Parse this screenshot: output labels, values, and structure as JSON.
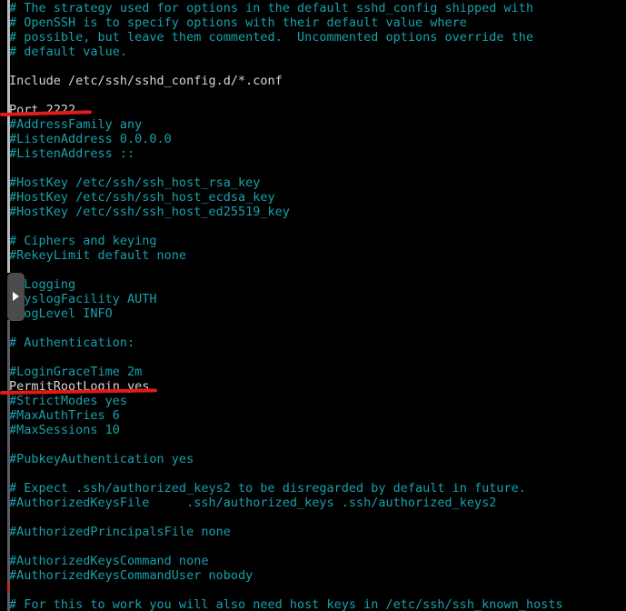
{
  "editor": {
    "colors": {
      "background": "#000000",
      "comment_text": "#17a1ab",
      "active_text": "#d6d6d6",
      "annotation": "#e01b18",
      "scrollbar_thumb": "#4b4b4b",
      "scrollbar_track": "#b9b9b9",
      "scrollbar_marker": "#c0261f"
    },
    "lines": [
      {
        "text": "# The strategy used for options in the default sshd_config shipped with",
        "style": "comment"
      },
      {
        "text": "# OpenSSH is to specify options with their default value where",
        "style": "comment"
      },
      {
        "text": "# possible, but leave them commented.  Uncommented options override the",
        "style": "comment"
      },
      {
        "text": "# default value.",
        "style": "comment"
      },
      {
        "text": "",
        "style": "blank"
      },
      {
        "text": "Include /etc/ssh/sshd_config.d/*.conf",
        "style": "active"
      },
      {
        "text": "",
        "style": "blank"
      },
      {
        "text": "Port 2222",
        "style": "active"
      },
      {
        "text": "#AddressFamily any",
        "style": "comment"
      },
      {
        "text": "#ListenAddress 0.0.0.0",
        "style": "comment"
      },
      {
        "text": "#ListenAddress ::",
        "style": "comment"
      },
      {
        "text": "",
        "style": "blank"
      },
      {
        "text": "#HostKey /etc/ssh/ssh_host_rsa_key",
        "style": "comment"
      },
      {
        "text": "#HostKey /etc/ssh/ssh_host_ecdsa_key",
        "style": "comment"
      },
      {
        "text": "#HostKey /etc/ssh/ssh_host_ed25519_key",
        "style": "comment"
      },
      {
        "text": "",
        "style": "blank"
      },
      {
        "text": "# Ciphers and keying",
        "style": "comment"
      },
      {
        "text": "#RekeyLimit default none",
        "style": "comment"
      },
      {
        "text": "",
        "style": "blank"
      },
      {
        "text": "# Logging",
        "style": "comment"
      },
      {
        "text": "#SyslogFacility AUTH",
        "style": "comment"
      },
      {
        "text": "#LogLevel INFO",
        "style": "comment"
      },
      {
        "text": "",
        "style": "blank"
      },
      {
        "text": "# Authentication:",
        "style": "comment"
      },
      {
        "text": "",
        "style": "blank"
      },
      {
        "text": "#LoginGraceTime 2m",
        "style": "comment"
      },
      {
        "text": "PermitRootLogin yes",
        "style": "active"
      },
      {
        "text": "#StrictModes yes",
        "style": "comment"
      },
      {
        "text": "#MaxAuthTries 6",
        "style": "comment"
      },
      {
        "text": "#MaxSessions 10",
        "style": "comment"
      },
      {
        "text": "",
        "style": "blank"
      },
      {
        "text": "#PubkeyAuthentication yes",
        "style": "comment"
      },
      {
        "text": "",
        "style": "blank"
      },
      {
        "text": "# Expect .ssh/authorized_keys2 to be disregarded by default in future.",
        "style": "comment"
      },
      {
        "text": "#AuthorizedKeysFile     .ssh/authorized_keys .ssh/authorized_keys2",
        "style": "comment"
      },
      {
        "text": "",
        "style": "blank"
      },
      {
        "text": "#AuthorizedPrincipalsFile none",
        "style": "comment"
      },
      {
        "text": "",
        "style": "blank"
      },
      {
        "text": "#AuthorizedKeysCommand none",
        "style": "comment"
      },
      {
        "text": "#AuthorizedKeysCommandUser nobody",
        "style": "comment"
      },
      {
        "text": "",
        "style": "blank"
      },
      {
        "text": "# For this to work you will also need host keys in /etc/ssh/ssh_known_hosts",
        "style": "comment"
      }
    ]
  },
  "annotations": [
    {
      "label": "Port 2222",
      "kind": "red-underline"
    },
    {
      "label": "PermitRootLogin yes",
      "kind": "red-underline"
    }
  ],
  "scrollbar": {
    "thumb_label": "scroll-thumb",
    "arrow_glyph": "▶"
  }
}
